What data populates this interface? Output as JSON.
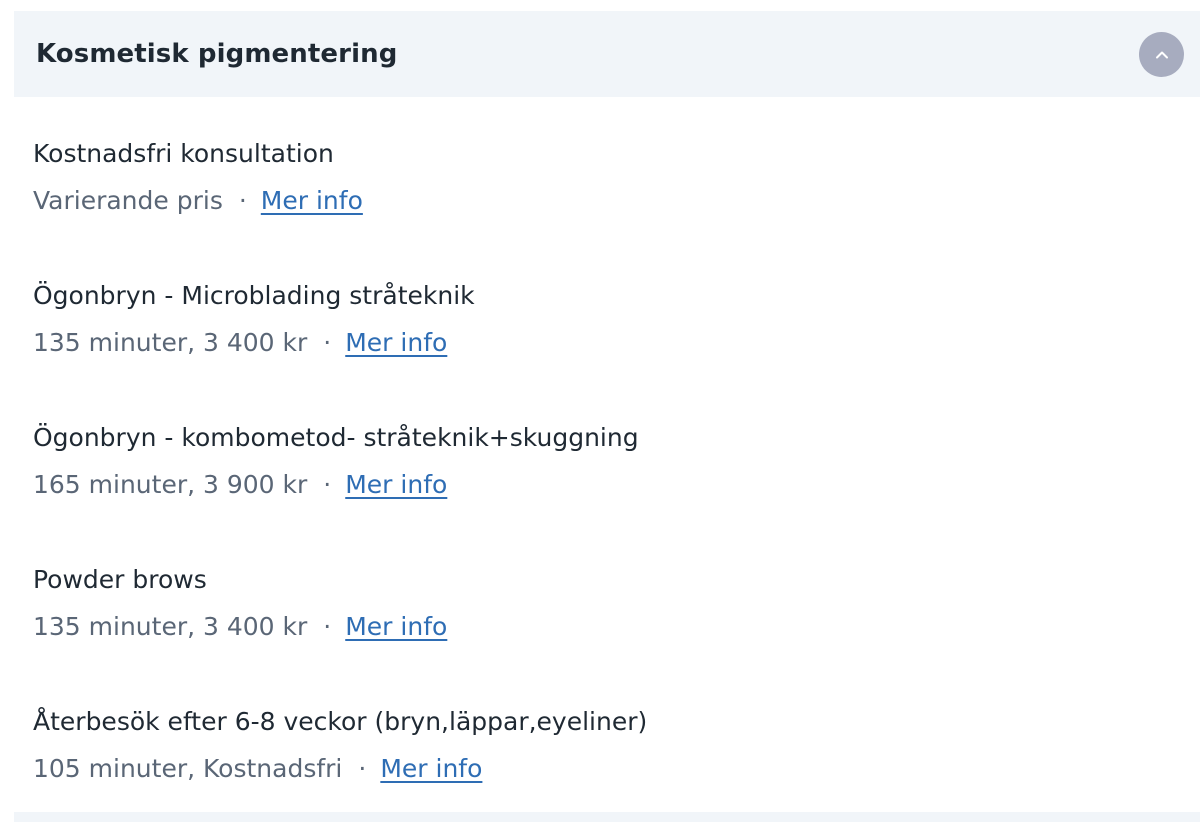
{
  "section": {
    "title": "Kosmetisk pigmentering",
    "toggle_icon": "chevron-up-icon",
    "colors": {
      "header_bg": "#f1f5f9",
      "toggle_bg": "#a7acbf",
      "link": "#2e6db4"
    }
  },
  "services": [
    {
      "name": "Kostnadsfri konsultation",
      "meta": "Varierande pris",
      "link": "Mer info"
    },
    {
      "name": "Ögonbryn - Microblading stråteknik",
      "meta": "135 minuter, 3 400 kr",
      "link": "Mer info"
    },
    {
      "name": "Ögonbryn - kombometod- stråteknik+skuggning",
      "meta": "165 minuter, 3 900 kr",
      "link": "Mer info"
    },
    {
      "name": "Powder brows",
      "meta": "135 minuter, 3 400 kr",
      "link": "Mer info"
    },
    {
      "name": "Återbesök efter 6-8 veckor (bryn,läppar,eyeliner)",
      "meta": "105 minuter, Kostnadsfri",
      "link": "Mer info"
    }
  ],
  "separator": "·"
}
